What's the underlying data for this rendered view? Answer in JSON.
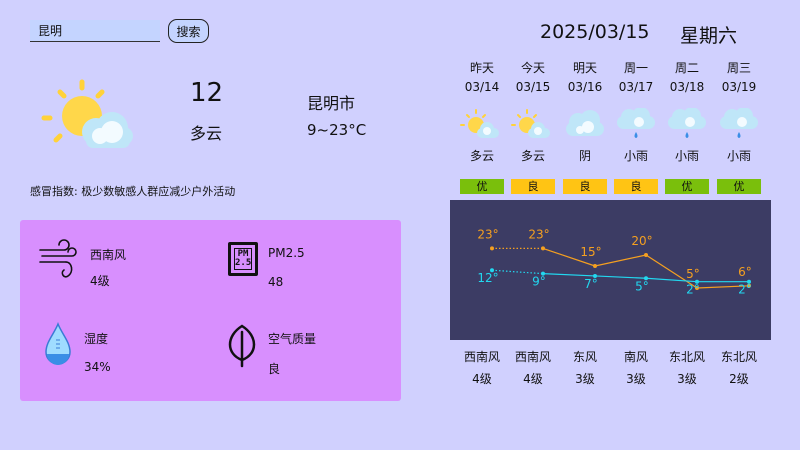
{
  "search": {
    "value": "昆明",
    "button_label": "搜索"
  },
  "current": {
    "temp": "12",
    "condition": "多云",
    "city": "昆明市",
    "range": "9~23°C",
    "cold_index": "感冒指数: 极少数敏感人群应减少户外活动"
  },
  "details": [
    {
      "title": "西南风",
      "value": "4级",
      "icon": "wind-icon"
    },
    {
      "title": "PM2.5",
      "value": "48",
      "icon": "pm25-icon",
      "icon_text": "PM\n2.5"
    },
    {
      "title": "湿度",
      "value": "34%",
      "icon": "humidity-drop-icon"
    },
    {
      "title": "空气质量",
      "value": "良",
      "icon": "leaf-icon"
    }
  ],
  "header": {
    "date": "2025/03/15",
    "weekday": "星期六"
  },
  "forecast": [
    {
      "day": "昨天",
      "date": "03/14",
      "cond": "多云",
      "icon": "partly-cloudy-icon",
      "aqi": "优",
      "wind_dir": "西南风",
      "wind_lvl": "4级"
    },
    {
      "day": "今天",
      "date": "03/15",
      "cond": "多云",
      "icon": "partly-cloudy-icon",
      "aqi": "良",
      "wind_dir": "西南风",
      "wind_lvl": "4级"
    },
    {
      "day": "明天",
      "date": "03/16",
      "cond": "阴",
      "icon": "cloud-icon",
      "aqi": "良",
      "wind_dir": "东风",
      "wind_lvl": "3级"
    },
    {
      "day": "周一",
      "date": "03/17",
      "cond": "小雨",
      "icon": "light-rain-icon",
      "aqi": "良",
      "wind_dir": "南风",
      "wind_lvl": "3级"
    },
    {
      "day": "周二",
      "date": "03/18",
      "cond": "小雨",
      "icon": "light-rain-icon",
      "aqi": "优",
      "wind_dir": "东北风",
      "wind_lvl": "3级"
    },
    {
      "day": "周三",
      "date": "03/19",
      "cond": "小雨",
      "icon": "light-rain-icon",
      "aqi": "优",
      "wind_dir": "东北风",
      "wind_lvl": "2级"
    }
  ],
  "colors": {
    "aqi_good": "#7abf0c",
    "aqi_moderate": "#ffc414",
    "high_line": "#f5a020",
    "low_line": "#22d8f0"
  },
  "chart_data": {
    "type": "line",
    "x": [
      "03/14",
      "03/15",
      "03/16",
      "03/17",
      "03/18",
      "03/19"
    ],
    "series": [
      {
        "values": [
          23,
          23,
          15,
          20,
          5,
          6
        ]
      },
      {
        "values": [
          12,
          9,
          7,
          5,
          2,
          2
        ]
      }
    ],
    "value_labels": {
      "high": [
        "23°",
        "23°",
        "15°",
        "20°",
        "5°",
        "6°"
      ],
      "low": [
        "12°",
        "9°",
        "7°",
        "5°",
        "2°",
        "2°"
      ]
    },
    "first_segment_dotted": true,
    "grid": false
  }
}
